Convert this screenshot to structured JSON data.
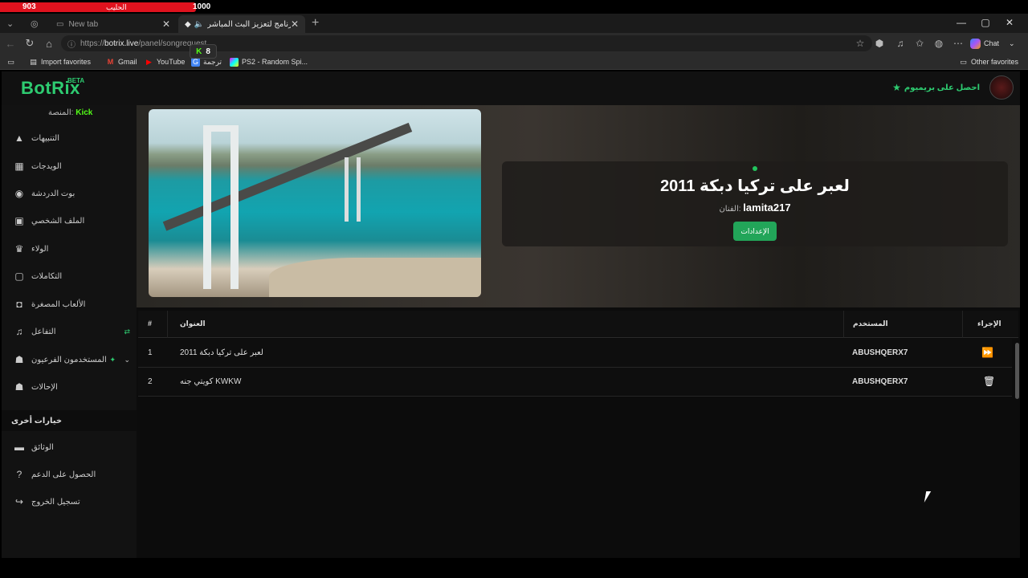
{
  "overlay": {
    "left_num": "903",
    "right_num": "1000",
    "name": "الحليب"
  },
  "browser": {
    "tabs": [
      {
        "title": "New tab"
      },
      {
        "title": "أفضل برنامج لتعزيز البث المباشر"
      }
    ],
    "url_scheme": "https://",
    "url_host": "botrix.live",
    "url_path": "/panel/songrequest",
    "chat_label": "Chat",
    "favorites": [
      "Import favorites",
      "Gmail",
      "YouTube",
      "ترجمة",
      "PS2 - Random Spi...",
      "Other favorites"
    ],
    "kick_badge_count": "8",
    "kick_badge_letter": "K"
  },
  "app": {
    "logo": "BotRix",
    "logo_beta": "BETA",
    "premium_label": "احصل على بريميوم",
    "platform_label": "المنصة:",
    "platform_value": "Kick",
    "nav": [
      {
        "label": "التنبيهات",
        "icon": "warning-icon"
      },
      {
        "label": "الويدجات",
        "icon": "widgets-icon"
      },
      {
        "label": "بوت الدردشة",
        "icon": "robot-icon"
      },
      {
        "label": "الملف الشخصي",
        "icon": "id-card-icon"
      },
      {
        "label": "الولاء",
        "icon": "trophy-icon"
      },
      {
        "label": "التكاملات",
        "icon": "integrations-icon"
      },
      {
        "label": "الألعاب المصغرة",
        "icon": "gamepad-icon"
      },
      {
        "label": "التفاعل",
        "icon": "music-icon"
      },
      {
        "label": "المستخدمون الفرعيون",
        "icon": "users-icon"
      },
      {
        "label": "الإحالات",
        "icon": "referrals-icon"
      }
    ],
    "section_other": "خيارات أخرى",
    "nav_other": [
      {
        "label": "الوثائق",
        "icon": "scroll-icon"
      },
      {
        "label": "الحصول على الدعم",
        "icon": "help-icon"
      },
      {
        "label": "تسجيل الخروج",
        "icon": "logout-icon"
      }
    ]
  },
  "now_playing": {
    "title": "لعبر على تركيا دبكة 2011",
    "artist_label": "الفنان:",
    "artist": "lamita217",
    "settings_button": "الإعدادات"
  },
  "queue": {
    "columns": {
      "num": "#",
      "title": "العنوان",
      "user": "المستخدم",
      "action": "الإجراء"
    },
    "rows": [
      {
        "num": "1",
        "title": "لعبر على تركيا دبكة 2011",
        "user": "ABUSHQERX7",
        "action_icon": "skip-icon"
      },
      {
        "num": "2",
        "title": "كويتي جنه KWKW",
        "user": "ABUSHQERX7",
        "action_icon": "trash-icon"
      }
    ]
  }
}
